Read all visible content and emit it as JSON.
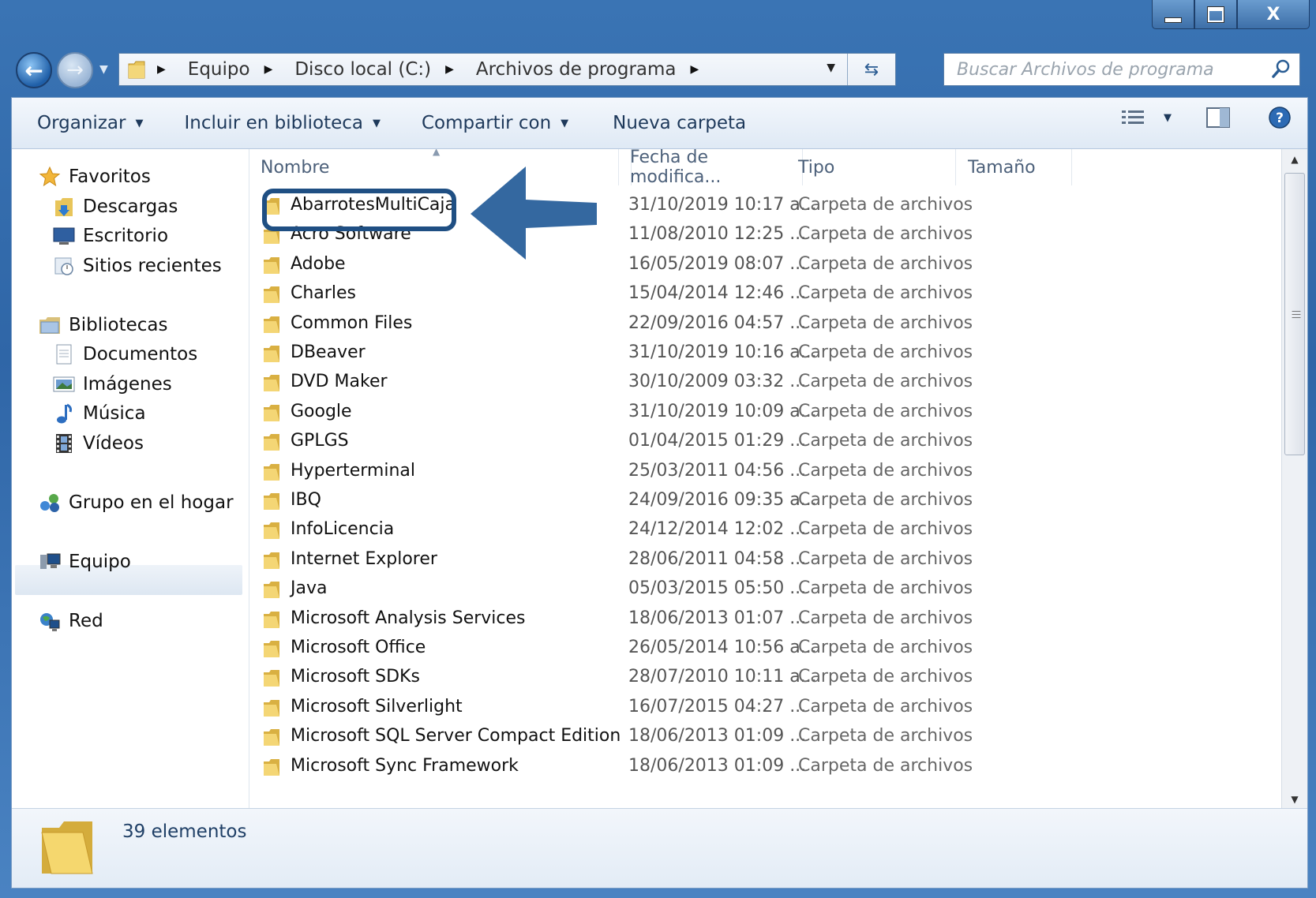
{
  "window": {
    "caption": {
      "minimize": "minimize",
      "maximize": "maximize",
      "close": "X"
    }
  },
  "address_bar": {
    "crumbs": [
      "Equipo",
      "Disco local (C:)",
      "Archivos de programa"
    ]
  },
  "search": {
    "placeholder": "Buscar Archivos de programa"
  },
  "toolbar": {
    "organize": "Organizar",
    "include_library": "Incluir en biblioteca",
    "share_with": "Compartir con",
    "new_folder": "Nueva carpeta"
  },
  "navpane": {
    "favorites": "Favoritos",
    "downloads": "Descargas",
    "desktop": "Escritorio",
    "recent": "Sitios recientes",
    "libraries": "Bibliotecas",
    "documents": "Documentos",
    "pictures": "Imágenes",
    "music": "Música",
    "videos": "Vídeos",
    "homegroup": "Grupo en el hogar",
    "computer": "Equipo",
    "network": "Red"
  },
  "columns": {
    "name": "Nombre",
    "date": "Fecha de modifica...",
    "type": "Tipo",
    "size": "Tamaño"
  },
  "files": [
    {
      "name": "AbarrotesMultiCaja",
      "date": "31/10/2019 10:17 a...",
      "type": "Carpeta de archivos"
    },
    {
      "name": "Acro Software",
      "date": "11/08/2010 12:25 ...",
      "type": "Carpeta de archivos"
    },
    {
      "name": "Adobe",
      "date": "16/05/2019 08:07 ...",
      "type": "Carpeta de archivos"
    },
    {
      "name": "Charles",
      "date": "15/04/2014 12:46 ...",
      "type": "Carpeta de archivos"
    },
    {
      "name": "Common Files",
      "date": "22/09/2016 04:57 ...",
      "type": "Carpeta de archivos"
    },
    {
      "name": "DBeaver",
      "date": "31/10/2019 10:16 a...",
      "type": "Carpeta de archivos"
    },
    {
      "name": "DVD Maker",
      "date": "30/10/2009 03:32 ...",
      "type": "Carpeta de archivos"
    },
    {
      "name": "Google",
      "date": "31/10/2019 10:09 a...",
      "type": "Carpeta de archivos"
    },
    {
      "name": "GPLGS",
      "date": "01/04/2015 01:29 ...",
      "type": "Carpeta de archivos"
    },
    {
      "name": "Hyperterminal",
      "date": "25/03/2011 04:56 ...",
      "type": "Carpeta de archivos"
    },
    {
      "name": "IBQ",
      "date": "24/09/2016 09:35 a...",
      "type": "Carpeta de archivos"
    },
    {
      "name": "InfoLicencia",
      "date": "24/12/2014 12:02 ...",
      "type": "Carpeta de archivos"
    },
    {
      "name": "Internet Explorer",
      "date": "28/06/2011 04:58 ...",
      "type": "Carpeta de archivos"
    },
    {
      "name": "Java",
      "date": "05/03/2015 05:50 ...",
      "type": "Carpeta de archivos"
    },
    {
      "name": "Microsoft Analysis Services",
      "date": "18/06/2013 01:07 ...",
      "type": "Carpeta de archivos"
    },
    {
      "name": "Microsoft Office",
      "date": "26/05/2014 10:56 a...",
      "type": "Carpeta de archivos"
    },
    {
      "name": "Microsoft SDKs",
      "date": "28/07/2010 10:11 a...",
      "type": "Carpeta de archivos"
    },
    {
      "name": "Microsoft Silverlight",
      "date": "16/07/2015 04:27 ...",
      "type": "Carpeta de archivos"
    },
    {
      "name": "Microsoft SQL Server Compact Edition",
      "date": "18/06/2013 01:09 ...",
      "type": "Carpeta de archivos"
    },
    {
      "name": "Microsoft Sync Framework",
      "date": "18/06/2013 01:09 ...",
      "type": "Carpeta de archivos"
    }
  ],
  "status": {
    "count": "39 elementos"
  },
  "colors": {
    "highlight": "#1f4f83",
    "arrow": "#3468a0",
    "frame": "#3a74b4"
  }
}
